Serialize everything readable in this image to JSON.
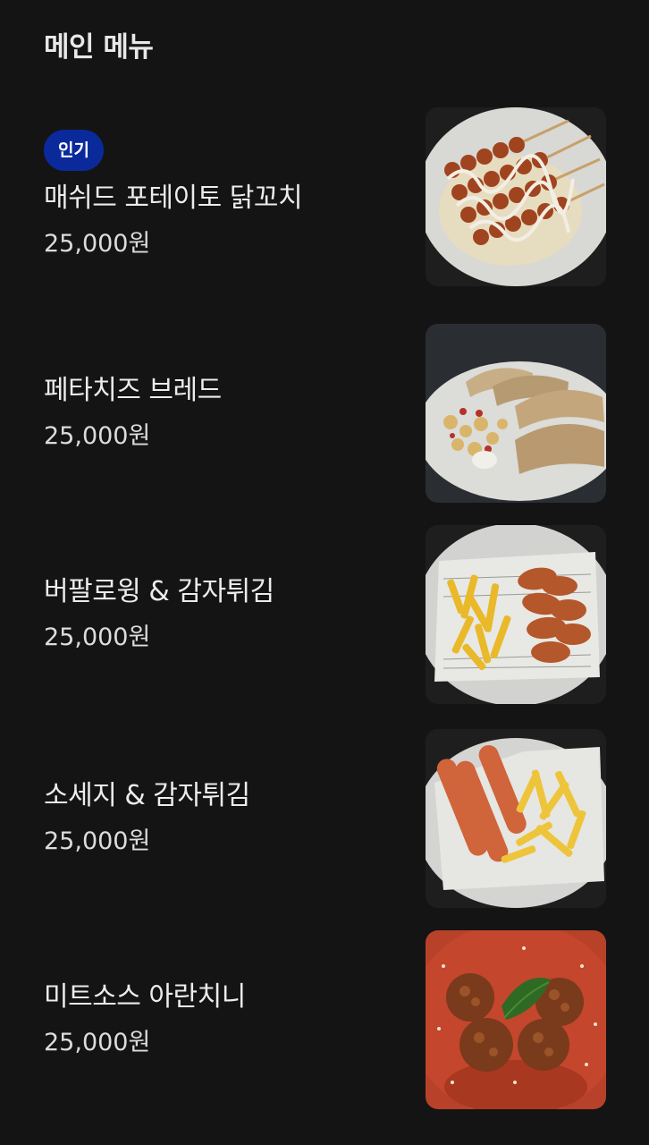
{
  "section": {
    "title": "메인 메뉴"
  },
  "menu_items": [
    {
      "badge": "인기",
      "name": "매쉬드 포테이토 닭꼬치",
      "price": "25,000원",
      "image": "mashed-potato-chicken-skewers"
    },
    {
      "badge": "",
      "name": "페타치즈 브레드",
      "price": "25,000원",
      "image": "feta-cheese-bread"
    },
    {
      "badge": "",
      "name": "버팔로윙 & 감자튀김",
      "price": "25,000원",
      "image": "buffalo-wings-fries"
    },
    {
      "badge": "",
      "name": "소세지 & 감자튀김",
      "price": "25,000원",
      "image": "sausage-fries"
    },
    {
      "badge": "",
      "name": "미트소스 아란치니",
      "price": "25,000원",
      "image": "meat-sauce-arancini"
    }
  ],
  "colors": {
    "background": "#141414",
    "badge_background": "#0a2a9c",
    "text_primary": "#ececec"
  }
}
